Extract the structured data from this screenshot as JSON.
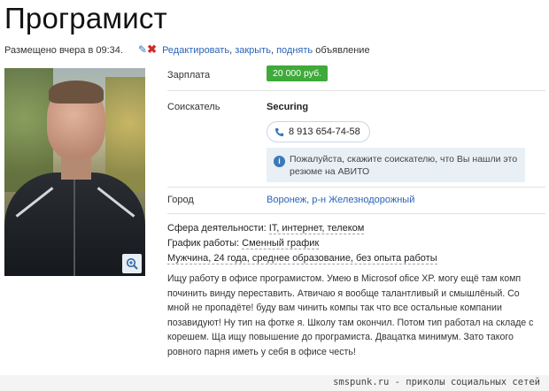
{
  "ad": {
    "title": "Програмист",
    "posted": "Размещено вчера в 09:34.",
    "actions": {
      "edit": "Редактировать",
      "close": "закрыть",
      "raise": "поднять",
      "suffix": "объявление"
    }
  },
  "fields": {
    "salary_label": "Зарплата",
    "salary_value": "20 000 руб.",
    "seeker_label": "Соискатель",
    "seeker_value": "Securing",
    "phone": "8 913 654-74-58",
    "info_note": "Пожалуйста, скажите соискателю, что Вы нашли это резюме на АВИТО",
    "city_label": "Город",
    "city_value": "Воронеж, р-н Железнодорожный"
  },
  "facts": {
    "sphere_label": "Сфера деятельности:",
    "sphere_value": "IT, интернет, телеком",
    "schedule_label": "График работы:",
    "schedule_value": "Сменный график",
    "profile": "Мужчина, 24 года, среднее образование, без опыта работы"
  },
  "description": "Ищу работу в офисе програмистом. Умею в Microsof ofice XP. могу ещё там комп починить винду переставить. Атвичаю я вообще талантливый и смышлёный. Со мной не пропадёте! буду вам чинить компы так что все остальные компании позавидуют! Ну тип на фотке я. Школу там окончил. Потом тип работал на складе с корешем. Ща ищу повышение до програмиста. Двацатка минимум. Зато такого ровного парня иметь у себя в офисе честь!",
  "watermark": "smspunk.ru - приколы социальных сетей",
  "colors": {
    "salary_badge": "#3faa3a",
    "link": "#2a64b8",
    "info_bg": "#e8f0f6"
  },
  "icons": [
    "pencil-icon",
    "delete-icon",
    "zoom-icon",
    "phone-icon",
    "info-icon"
  ]
}
